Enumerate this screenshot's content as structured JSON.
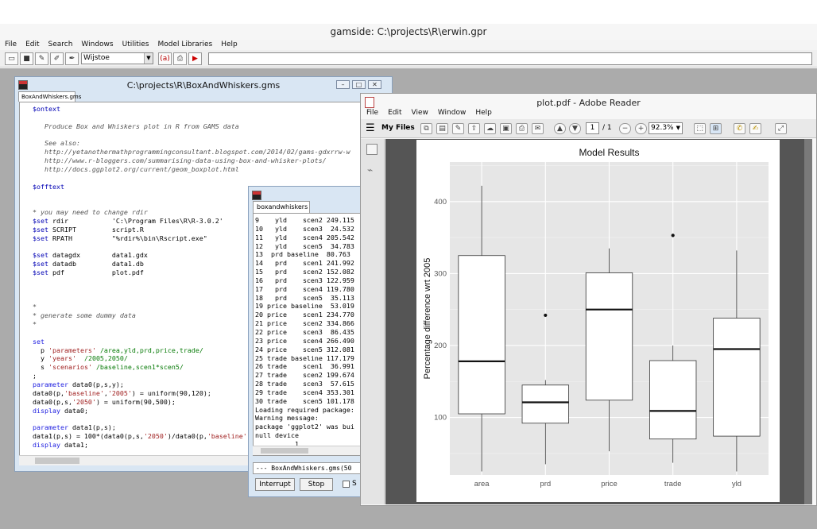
{
  "main_window": {
    "title": "gamside: C:\\projects\\R\\erwin.gpr",
    "menu": [
      "File",
      "Edit",
      "Search",
      "Windows",
      "Utilities",
      "Model Libraries",
      "Help"
    ],
    "workspace_combo": "Wijstoe",
    "toolbar_a": "(a)"
  },
  "editor": {
    "title": "C:\\projects\\R\\BoxAndWhiskers.gms",
    "tab": "BoxAndWhiskers.gms"
  },
  "process": {
    "tab": "boxandwhiskers",
    "log": [
      "9    yld    scen2 249.115",
      "10   yld    scen3  24.532",
      "11   yld    scen4 205.542",
      "12   yld    scen5  34.783",
      "13  prd baseline  80.763",
      "14   prd    scen1 241.992",
      "15   prd    scen2 152.082",
      "16   prd    scen3 122.959",
      "17   prd    scen4 119.780",
      "18   prd    scen5  35.113",
      "19 price baseline  53.019",
      "20 price    scen1 234.770",
      "21 price    scen2 334.866",
      "22 price    scen3  86.435",
      "23 price    scen4 266.490",
      "24 price    scen5 312.081",
      "25 trade baseline 117.179",
      "26 trade    scen1  36.991",
      "27 trade    scen2 199.674",
      "28 trade    scen3  57.615",
      "29 trade    scen4 353.301",
      "30 trade    scen5 101.178",
      "Loading required package:",
      "Warning message:",
      "package 'ggplot2' was bui",
      "null device",
      "          1",
      "--- BoxAndWhiskers.gms(50"
    ],
    "status_line": "--- BoxAndWhiskers.gms(50",
    "interrupt_label": "Interrupt",
    "stop_label": "Stop",
    "checkbox_label": "S"
  },
  "reader": {
    "title": "plot.pdf - Adobe Reader",
    "menu": [
      "File",
      "Edit",
      "View",
      "Window",
      "Help"
    ],
    "my_files": "My Files",
    "page_current": "1",
    "page_total": "/ 1",
    "zoom": "92.3%"
  },
  "chart_data": {
    "type": "box",
    "title": "Model Results",
    "xlabel": "",
    "ylabel": "Percentage difference wrt 2005",
    "categories": [
      "area",
      "prd",
      "price",
      "trade",
      "yld"
    ],
    "ylim": [
      20,
      455
    ],
    "yticks": [
      100,
      200,
      300,
      400
    ],
    "grid": true,
    "boxes": [
      {
        "name": "area",
        "whisker_low": 25,
        "q1": 105,
        "median": 178,
        "q3": 325,
        "whisker_high": 422,
        "outliers": []
      },
      {
        "name": "prd",
        "whisker_low": 35,
        "q1": 92,
        "median": 121,
        "q3": 145,
        "whisker_high": 152,
        "outliers": [
          242
        ]
      },
      {
        "name": "price",
        "whisker_low": 53,
        "q1": 124,
        "median": 250,
        "q3": 301,
        "whisker_high": 335,
        "outliers": []
      },
      {
        "name": "trade",
        "whisker_low": 37,
        "q1": 70,
        "median": 109,
        "q3": 179,
        "whisker_high": 200,
        "outliers": [
          353
        ]
      },
      {
        "name": "yld",
        "whisker_low": 25,
        "q1": 74,
        "median": 195,
        "q3": 238,
        "whisker_high": 332,
        "outliers": []
      }
    ]
  }
}
